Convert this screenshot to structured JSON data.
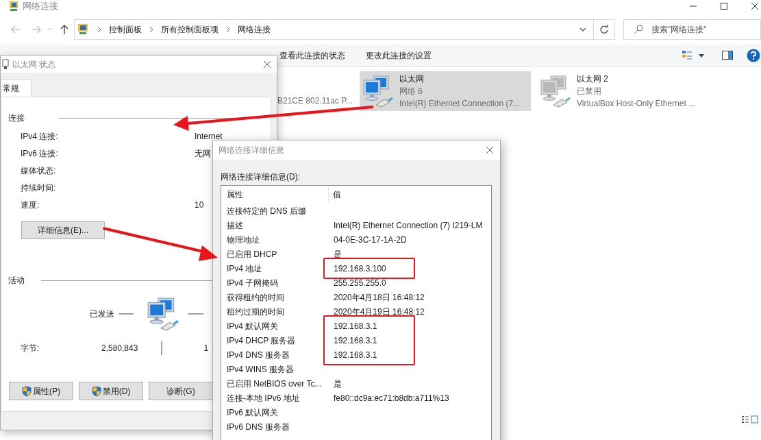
{
  "explorer": {
    "title": "网络连接",
    "breadcrumb": [
      "控制面板",
      "所有控制面板项",
      "网络连接"
    ],
    "search": {
      "placeholder": "搜索\"网络连接\""
    },
    "toolbar": [
      "查看此连接的状态",
      "更改此连接的设置"
    ],
    "partial_item_text": "B21CE 802.11ac P...",
    "connections": [
      {
        "name": "以太网",
        "network": "网络 6",
        "adapter": "Intel(R) Ethernet Connection (7...",
        "selected": true,
        "disabled": false
      },
      {
        "name": "以太网 2",
        "network": "已禁用",
        "adapter": "VirtualBox Host-Only Ethernet ...",
        "selected": false,
        "disabled": true
      }
    ]
  },
  "status_dialog": {
    "title": "以太网 状态",
    "tabs": [
      {
        "label": "常规",
        "selected": true
      }
    ],
    "connection_heading": "连接",
    "rows": [
      {
        "label": "IPv4 连接:",
        "value": "Internet"
      },
      {
        "label": "IPv6 连接:",
        "value": "无网"
      },
      {
        "label": "媒体状态:"
      },
      {
        "label": "持续时间:"
      },
      {
        "label": "速度:",
        "value": "10"
      }
    ],
    "details_button": "详细信息(E)...",
    "activity_heading": "活动",
    "sent_label": "已发送",
    "bytes_label": "字节:",
    "bytes_sent": "2,580,843",
    "bytes_received": "1",
    "buttons": [
      {
        "label": "属性(P)",
        "shield": true
      },
      {
        "label": "禁用(D)",
        "shield": true
      },
      {
        "label": "诊断(G)",
        "shield": false
      }
    ]
  },
  "details_dialog": {
    "title": "网络连接详细信息",
    "list_label": "网络连接详细信息(D):",
    "columns": [
      "属性",
      "值"
    ],
    "rows": [
      {
        "property": "连接特定的 DNS 后缀",
        "highlighted": false
      },
      {
        "property": "描述",
        "value": "Intel(R) Ethernet Connection (7) I219-LM",
        "highlighted": false
      },
      {
        "property": "物理地址",
        "value": "04-0E-3C-17-1A-2D",
        "highlighted": false
      },
      {
        "property": "已启用 DHCP",
        "value": "是",
        "highlighted": false
      },
      {
        "property": "IPv4 地址",
        "value": "192.168.3.100",
        "highlighted": true
      },
      {
        "property": "IPv4 子网掩码",
        "value": "255.255.255.0",
        "highlighted": false
      },
      {
        "property": "获得租约的时间",
        "value": "2020年4月18日 16:48:12",
        "highlighted": false
      },
      {
        "property": "租约过期的时间",
        "value": "2020年4月19日 16:48:12",
        "highlighted": false
      },
      {
        "property": "IPv4 默认网关",
        "value": "192.168.3.1",
        "highlighted": true
      },
      {
        "property": "IPv4 DHCP 服务器",
        "value": "192.168.3.1",
        "highlighted": true
      },
      {
        "property": "IPv4 DNS 服务器",
        "value": "192.168.3.1",
        "highlighted": true
      },
      {
        "property": "IPv4 WINS 服务器",
        "highlighted": false
      },
      {
        "property": "已启用 NetBIOS over Tc...",
        "value": "是",
        "highlighted": false
      },
      {
        "property": "连接-本地 IPv6 地址",
        "value": "fe80::dc9a:ec71:b8db:a711%13",
        "highlighted": false
      },
      {
        "property": "IPv6 默认网关",
        "highlighted": false
      },
      {
        "property": "IPv6 DNS 服务器",
        "highlighted": false
      }
    ]
  }
}
